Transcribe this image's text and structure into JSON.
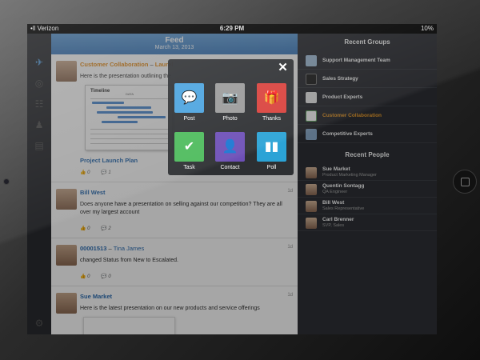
{
  "status_bar": {
    "carrier": "•ll Verizon",
    "time": "6:29 PM",
    "battery": "10%"
  },
  "feed": {
    "title": "Feed",
    "date": "March 13, 2013",
    "posts": [
      {
        "group": "Customer Collaboration",
        "dash": "–",
        "author": "Laurel",
        "text": "Here is the presentation outlining the",
        "attachment_title": "Timeline",
        "attachment_sub": "DATA",
        "link": "Project Launch Plan",
        "likes": "0",
        "comments": "1"
      },
      {
        "author": "Bill West",
        "age": "1d",
        "text": "Does anyone have a presentation on selling against our competition?  They are all over my largest account",
        "likes": "0",
        "comments": "2"
      },
      {
        "case": "00001513",
        "dash": "–",
        "author": "Tina James",
        "age": "1d",
        "text": "changed Status from New to Escalated.",
        "likes": "0",
        "comments": "0"
      },
      {
        "author": "Sue Market",
        "age": "1d",
        "text": "Here is the latest presentation on our new products and service offerings"
      }
    ]
  },
  "actions": {
    "close_label": "✕",
    "items": [
      {
        "label": "Post",
        "icon": "speech-bubble-icon",
        "color": "#4aa3df",
        "glyph": "💬"
      },
      {
        "label": "Photo",
        "icon": "camera-icon",
        "color": "#9a9a9a",
        "glyph": "📷"
      },
      {
        "label": "Thanks",
        "icon": "gift-icon",
        "color": "#d9413c",
        "glyph": "🎁"
      },
      {
        "label": "Task",
        "icon": "checkmark-icon",
        "color": "#4dbb5c",
        "glyph": "✔"
      },
      {
        "label": "Contact",
        "icon": "contact-card-icon",
        "color": "#6d4fb7",
        "glyph": "👤"
      },
      {
        "label": "Poll",
        "icon": "bar-chart-icon",
        "color": "#2ba3d6",
        "glyph": "▮"
      }
    ]
  },
  "recent_groups": {
    "title": "Recent Groups",
    "items": [
      {
        "label": "Support Management Team",
        "active": false
      },
      {
        "label": "Sales Strategy",
        "active": false
      },
      {
        "label": "Product Experts",
        "active": false
      },
      {
        "label": "Customer Collaboration",
        "active": true
      },
      {
        "label": "Competitive Experts",
        "active": false
      }
    ]
  },
  "recent_people": {
    "title": "Recent People",
    "items": [
      {
        "name": "Sue Market",
        "role": "Product Marketing Manager"
      },
      {
        "name": "Quentin Sontagg",
        "role": "QA Engineer"
      },
      {
        "name": "Bill West",
        "role": "Sales Representative"
      },
      {
        "name": "Carl Brenner",
        "role": "SVP, Sales"
      }
    ]
  },
  "colors": {
    "accent": "#2f6fb3",
    "highlight": "#f0a030",
    "header": "#4a8ac8"
  }
}
